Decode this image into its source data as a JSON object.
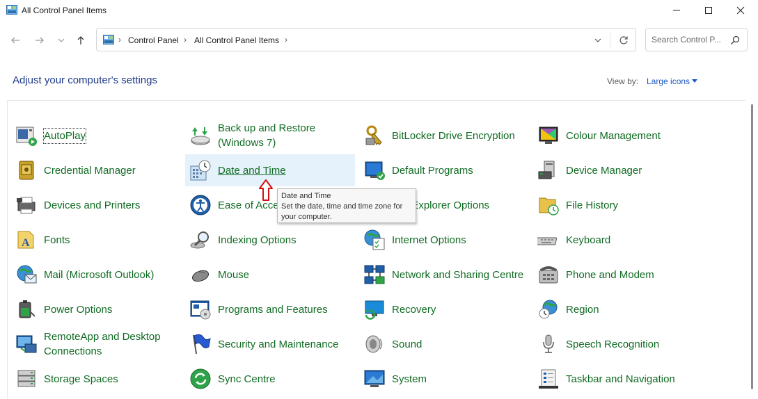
{
  "window": {
    "title": "All Control Panel Items",
    "minimize_icon": "minimize-icon",
    "maximize_icon": "maximize-icon",
    "close_icon": "close-icon"
  },
  "nav": {
    "back_icon": "back-arrow-icon",
    "forward_icon": "forward-arrow-icon",
    "recent_icon": "chevron-down-icon",
    "up_icon": "up-arrow-icon"
  },
  "address": {
    "crumbs": [
      "Control Panel",
      "All Control Panel Items"
    ],
    "separator": "›"
  },
  "search": {
    "placeholder": "Search Control P..."
  },
  "header": {
    "title": "Adjust your computer's settings",
    "view_by_label": "View by:",
    "view_by_value": "Large icons"
  },
  "items": [
    {
      "label": "AutoPlay",
      "icon": "autoplay-icon"
    },
    {
      "label": "Back up and Restore (Windows 7)",
      "icon": "backup-restore-icon"
    },
    {
      "label": "BitLocker Drive Encryption",
      "icon": "bitlocker-icon"
    },
    {
      "label": "Colour Management",
      "icon": "colour-management-icon"
    },
    {
      "label": "Credential Manager",
      "icon": "credential-manager-icon"
    },
    {
      "label": "Date and Time",
      "icon": "date-time-icon"
    },
    {
      "label": "Default Programs",
      "icon": "default-programs-icon"
    },
    {
      "label": "Device Manager",
      "icon": "device-manager-icon"
    },
    {
      "label": "Devices and Printers",
      "icon": "printer-icon"
    },
    {
      "label": "Ease of Access Centre",
      "icon": "ease-of-access-icon"
    },
    {
      "label": "File Explorer Options",
      "icon": "folder-options-icon"
    },
    {
      "label": "File History",
      "icon": "file-history-icon"
    },
    {
      "label": "Fonts",
      "icon": "fonts-icon"
    },
    {
      "label": "Indexing Options",
      "icon": "indexing-icon"
    },
    {
      "label": "Internet Options",
      "icon": "internet-options-icon"
    },
    {
      "label": "Keyboard",
      "icon": "keyboard-icon"
    },
    {
      "label": "Mail (Microsoft Outlook)",
      "icon": "mail-icon"
    },
    {
      "label": "Mouse",
      "icon": "mouse-icon"
    },
    {
      "label": "Network and Sharing Centre",
      "icon": "network-icon"
    },
    {
      "label": "Phone and Modem",
      "icon": "phone-icon"
    },
    {
      "label": "Power Options",
      "icon": "power-icon"
    },
    {
      "label": "Programs and Features",
      "icon": "programs-icon"
    },
    {
      "label": "Recovery",
      "icon": "recovery-icon"
    },
    {
      "label": "Region",
      "icon": "region-icon"
    },
    {
      "label": "RemoteApp and Desktop Connections",
      "icon": "remoteapp-icon"
    },
    {
      "label": "Security and Maintenance",
      "icon": "flag-icon"
    },
    {
      "label": "Sound",
      "icon": "sound-icon"
    },
    {
      "label": "Speech Recognition",
      "icon": "microphone-icon"
    },
    {
      "label": "Storage Spaces",
      "icon": "storage-icon"
    },
    {
      "label": "Sync Centre",
      "icon": "sync-icon"
    },
    {
      "label": "System",
      "icon": "system-icon"
    },
    {
      "label": "Taskbar and Navigation",
      "icon": "taskbar-icon"
    }
  ],
  "tooltip": {
    "title": "Date and Time",
    "body": "Set the date, time and time zone for your computer."
  },
  "colors": {
    "link_green": "#106b23",
    "title_blue": "#1e3a8a",
    "hover_bg": "#e5f1fb",
    "arrow_red": "#d01010"
  }
}
